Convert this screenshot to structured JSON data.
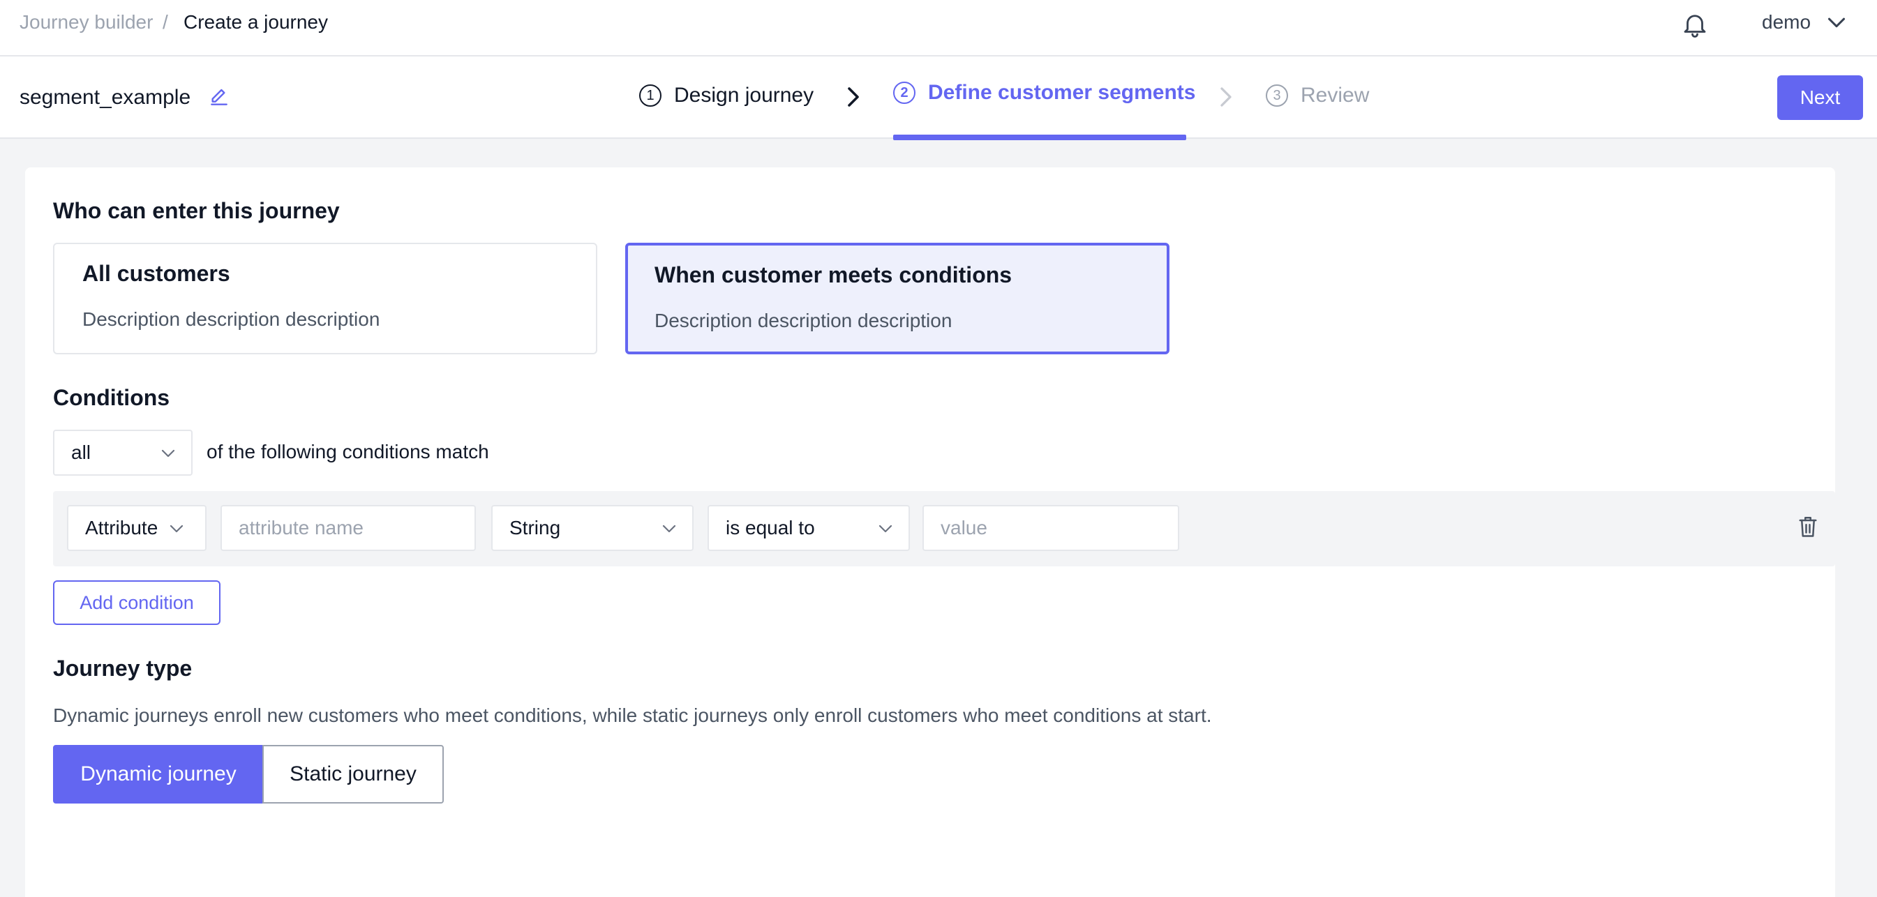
{
  "breadcrumb": {
    "parent": "Journey builder",
    "separator": "/",
    "current": "Create a journey"
  },
  "header": {
    "user": "demo"
  },
  "journey": {
    "name": "segment_example"
  },
  "steps": [
    {
      "number": "1",
      "label": "Design journey",
      "state": "done"
    },
    {
      "number": "2",
      "label": "Define customer segments",
      "state": "active"
    },
    {
      "number": "3",
      "label": "Review",
      "state": "upcoming"
    }
  ],
  "actions": {
    "next": "Next"
  },
  "entry": {
    "heading": "Who can enter this journey",
    "options": [
      {
        "title": "All customers",
        "description": "Description description description",
        "selected": false
      },
      {
        "title": "When customer meets conditions",
        "description": "Description description description",
        "selected": true
      }
    ]
  },
  "conditions": {
    "heading": "Conditions",
    "match_mode": "all",
    "match_text": "of the following conditions match",
    "row": {
      "source": "Attribute",
      "attribute_placeholder": "attribute name",
      "type": "String",
      "operator": "is equal to",
      "value_placeholder": "value"
    },
    "add_label": "Add condition"
  },
  "journey_type": {
    "heading": "Journey type",
    "description": "Dynamic journeys enroll new customers who meet conditions, while static journeys only enroll customers who meet conditions at start.",
    "options": [
      "Dynamic journey",
      "Static journey"
    ],
    "selected": "Dynamic journey"
  },
  "colors": {
    "accent": "#6366f1",
    "selected_bg": "#eef0fc",
    "page_bg": "#f3f4f6"
  },
  "icons": [
    "bell-icon",
    "chevron-down-icon",
    "edit-icon",
    "chevron-right-icon",
    "trash-icon"
  ]
}
